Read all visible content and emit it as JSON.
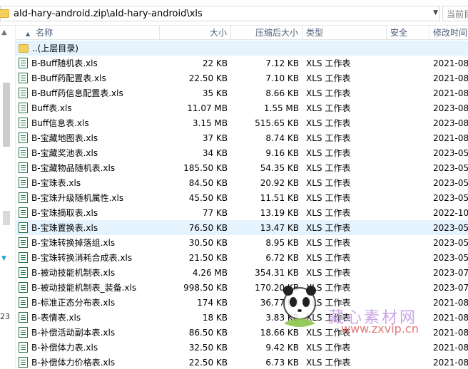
{
  "address_bar": {
    "path": "ald-hary-android.zip\\ald-hary-android\\xls",
    "search_placeholder": "当前目录"
  },
  "nav_pane": {
    "partial_number": "23"
  },
  "columns": {
    "name": "名称",
    "size": "大小",
    "compressed": "压缩后大小",
    "type": "类型",
    "security": "安全",
    "modified": "修改时间"
  },
  "parent_row": {
    "name": "..(上层目录)"
  },
  "files": [
    {
      "name": "B-Buff随机表.xls",
      "size": "22 KB",
      "compressed": "7.12 KB",
      "type": "XLS 工作表",
      "security": "",
      "modified": "2021-08"
    },
    {
      "name": "B-Buff药配置表.xls",
      "size": "22.50 KB",
      "compressed": "7.10 KB",
      "type": "XLS 工作表",
      "security": "",
      "modified": "2021-08"
    },
    {
      "name": "B-Buff药信息配置表.xls",
      "size": "35 KB",
      "compressed": "8.66 KB",
      "type": "XLS 工作表",
      "security": "",
      "modified": "2021-08"
    },
    {
      "name": "Buff表.xls",
      "size": "11.07 MB",
      "compressed": "1.55 MB",
      "type": "XLS 工作表",
      "security": "",
      "modified": "2023-08"
    },
    {
      "name": "Buff信息表.xls",
      "size": "3.15 MB",
      "compressed": "515.65 KB",
      "type": "XLS 工作表",
      "security": "",
      "modified": "2023-08"
    },
    {
      "name": "B-宝藏地图表.xls",
      "size": "37 KB",
      "compressed": "8.74 KB",
      "type": "XLS 工作表",
      "security": "",
      "modified": "2021-08"
    },
    {
      "name": "B-宝藏奖池表.xls",
      "size": "34 KB",
      "compressed": "9.16 KB",
      "type": "XLS 工作表",
      "security": "",
      "modified": "2023-05"
    },
    {
      "name": "B-宝藏物品随机表.xls",
      "size": "185.50 KB",
      "compressed": "54.35 KB",
      "type": "XLS 工作表",
      "security": "",
      "modified": "2023-05"
    },
    {
      "name": "B-宝珠表.xls",
      "size": "84.50 KB",
      "compressed": "20.92 KB",
      "type": "XLS 工作表",
      "security": "",
      "modified": "2023-05"
    },
    {
      "name": "B-宝珠升级随机属性.xls",
      "size": "45.50 KB",
      "compressed": "11.51 KB",
      "type": "XLS 工作表",
      "security": "",
      "modified": "2023-05"
    },
    {
      "name": "B-宝珠摘取表.xls",
      "size": "77 KB",
      "compressed": "13.19 KB",
      "type": "XLS 工作表",
      "security": "",
      "modified": "2022-10"
    },
    {
      "name": "B-宝珠置换表.xls",
      "size": "76.50 KB",
      "compressed": "13.47 KB",
      "type": "XLS 工作表",
      "security": "",
      "modified": "2023-05",
      "selected": true
    },
    {
      "name": "B-宝珠转换掉落组.xls",
      "size": "30.50 KB",
      "compressed": "8.95 KB",
      "type": "XLS 工作表",
      "security": "",
      "modified": "2023-05"
    },
    {
      "name": "B-宝珠转换消耗合成表.xls",
      "size": "21.50 KB",
      "compressed": "6.72 KB",
      "type": "XLS 工作表",
      "security": "",
      "modified": "2023-05"
    },
    {
      "name": "B-被动技能机制表.xls",
      "size": "4.26 MB",
      "compressed": "354.31 KB",
      "type": "XLS 工作表",
      "security": "",
      "modified": "2023-07"
    },
    {
      "name": "B-被动技能机制表_装备.xls",
      "size": "998.50 KB",
      "compressed": "170.20 KB",
      "type": "XLS 工作表",
      "security": "",
      "modified": "2023-07"
    },
    {
      "name": "B-标准正态分布表.xls",
      "size": "174 KB",
      "compressed": "36.77 KB",
      "type": "XLS 工作表",
      "security": "",
      "modified": "2021-08"
    },
    {
      "name": "B-表情表.xls",
      "size": "18 KB",
      "compressed": "3.83 KB",
      "type": "XLS 工作表",
      "security": "",
      "modified": "2021-08"
    },
    {
      "name": "B-补偿活动副本表.xls",
      "size": "86.50 KB",
      "compressed": "18.66 KB",
      "type": "XLS 工作表",
      "security": "",
      "modified": "2021-08"
    },
    {
      "name": "B-补偿体力表.xls",
      "size": "32.50 KB",
      "compressed": "9.42 KB",
      "type": "XLS 工作表",
      "security": "",
      "modified": "2021-08"
    },
    {
      "name": "B-补偿体力价格表.xls",
      "size": "22.50 KB",
      "compressed": "6.73 KB",
      "type": "XLS 工作表",
      "security": "",
      "modified": "2021-08"
    }
  ],
  "watermark": {
    "title": "藏心素材网",
    "url": "www.zxvip.cn"
  }
}
